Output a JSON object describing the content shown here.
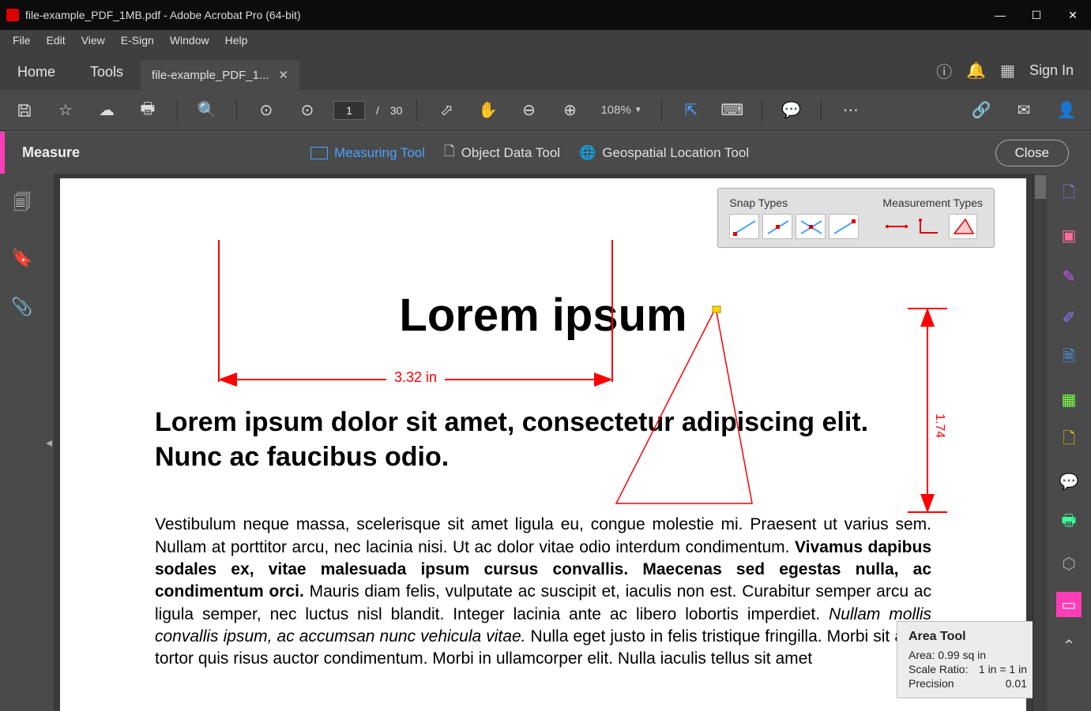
{
  "window": {
    "title": "file-example_PDF_1MB.pdf - Adobe Acrobat Pro (64-bit)"
  },
  "menu": {
    "file": "File",
    "edit": "Edit",
    "view": "View",
    "esign": "E-Sign",
    "window": "Window",
    "help": "Help"
  },
  "tabs": {
    "home": "Home",
    "tools": "Tools",
    "doc": "file-example_PDF_1..."
  },
  "signin": "Sign In",
  "toolbar": {
    "page_current": "1",
    "page_sep": "/",
    "page_total": "30",
    "zoom": "108%"
  },
  "measure": {
    "title": "Measure",
    "measuring": "Measuring Tool",
    "objectdata": "Object Data Tool",
    "geospatial": "Geospatial Location Tool",
    "close": "Close"
  },
  "snap": {
    "types": "Snap Types",
    "mtypes": "Measurement Types"
  },
  "doc": {
    "h1": "Lorem ipsum",
    "h2": "Lorem ipsum dolor sit amet, consectetur adipiscing elit. Nunc ac faucibus odio.",
    "p1a": "Vestibulum neque massa, scelerisque sit amet ligula eu, congue molestie mi. Praesent ut varius sem. Nullam at porttitor arcu, nec lacinia nisi. Ut ac dolor vitae odio interdum condimentum. ",
    "p1b": "Vivamus dapibus sodales ex, vitae malesuada ipsum cursus convallis. Maecenas sed egestas nulla, ac condimentum orci.",
    "p1c": " Mauris diam felis, vulputate ac suscipit et, iaculis non est. Curabitur semper arcu ac ligula semper, nec luctus nisl blandit. Integer lacinia ante ac libero lobortis imperdiet. ",
    "p1d": "Nullam mollis convallis ipsum, ac accumsan nunc vehicula vitae.",
    "p1e": " Nulla eget justo in felis tristique fringilla. Morbi sit amet tortor quis risus auctor condimentum. Morbi in ullamcorper elit. Nulla iaculis tellus sit amet"
  },
  "dims": {
    "width": "3.32 in",
    "height": "1.74"
  },
  "areatool": {
    "title": "Area Tool",
    "area_label": "Area:",
    "area_value": "0.99 sq in",
    "scale_label": "Scale Ratio:",
    "scale_value": "1 in = 1 in",
    "prec_label": "Precision",
    "prec_value": "0.01"
  }
}
